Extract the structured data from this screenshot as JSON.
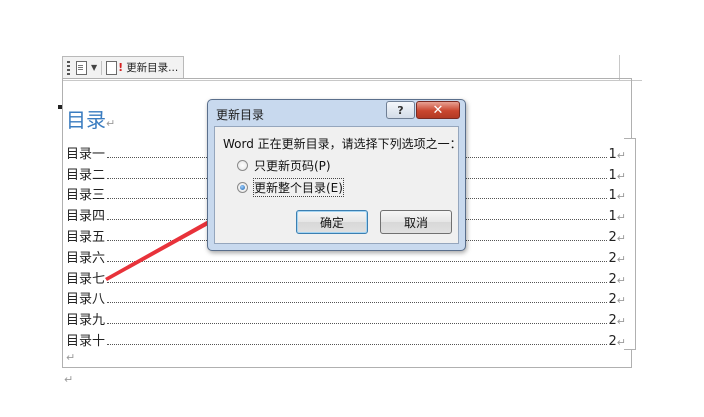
{
  "content_control": {
    "tab_label": "更新目录..."
  },
  "document": {
    "toc_title": "目录",
    "paragraph_mark": "↵",
    "entries": [
      {
        "text": "目录一",
        "page": "1"
      },
      {
        "text": "目录二",
        "page": "1"
      },
      {
        "text": "目录三",
        "page": "1"
      },
      {
        "text": "目录四",
        "page": "1"
      },
      {
        "text": "目录五",
        "page": "2"
      },
      {
        "text": "目录六",
        "page": "2"
      },
      {
        "text": "目录七",
        "page": "2"
      },
      {
        "text": "目录八",
        "page": "2"
      },
      {
        "text": "目录九",
        "page": "2"
      },
      {
        "text": "目录十",
        "page": "2"
      }
    ]
  },
  "dialog": {
    "title": "更新目录",
    "help_label": "?",
    "close_label": "✕",
    "message": "Word 正在更新目录，请选择下列选项之一：",
    "options": [
      {
        "label": "只更新页码(P)",
        "selected": false
      },
      {
        "label": "更新整个目录(E)",
        "selected": true
      }
    ],
    "ok_label": "确定",
    "cancel_label": "取消"
  },
  "colors": {
    "title_blue": "#3a7cc0",
    "arrow_red": "#e8323a",
    "dialog_frame": "#c8d9ee"
  }
}
